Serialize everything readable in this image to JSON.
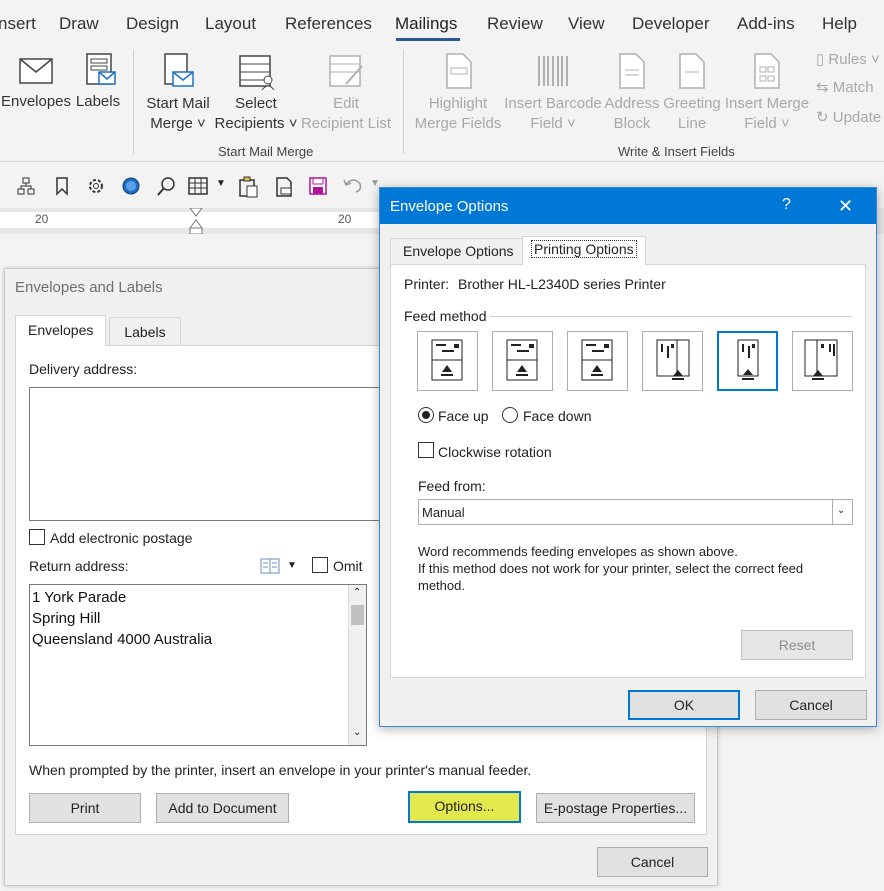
{
  "ribbon_tabs": [
    "nsert",
    "Draw",
    "Design",
    "Layout",
    "References",
    "Mailings",
    "Review",
    "View",
    "Developer",
    "Add-ins",
    "Help"
  ],
  "ribbon": {
    "envelopes": "Envelopes",
    "labels": "Labels",
    "start_mail_merge_1": "Start Mail",
    "start_mail_merge_2": "Merge ˅",
    "select_recipients_1": "Select",
    "select_recipients_2": "Recipients ˅",
    "edit_list_1": "Edit",
    "edit_list_2": "Recipient List",
    "highlight_1": "Highlight",
    "highlight_2": "Merge Fields",
    "barcode_1": "Insert Barcode",
    "barcode_2": "Field ˅",
    "address_1": "Address",
    "address_2": "Block",
    "greeting_1": "Greeting",
    "greeting_2": "Line",
    "merge_field_1": "Insert Merge",
    "merge_field_2": "Field ˅",
    "rules": "Rules ˅",
    "match": "Match",
    "update": "Update",
    "group_start": "Start Mail Merge",
    "group_write": "Write & Insert Fields"
  },
  "ruler": {
    "left_mark": "20",
    "right_mark": "20"
  },
  "env_dialog": {
    "title": "Envelopes and Labels",
    "tab_envelopes": "Envelopes",
    "tab_labels": "Labels",
    "delivery_label": "Delivery address:",
    "add_postage": "Add electronic postage",
    "return_label": "Return address:",
    "omit": "Omit",
    "return_lines": [
      "1 York Parade",
      "Spring Hill",
      "Queensland 4000 Australia"
    ],
    "prompt": "When prompted by the printer, insert an envelope in your printer's manual feeder.",
    "print": "Print",
    "add_to_doc": "Add to Document",
    "options": "Options...",
    "epostage": "E-postage Properties...",
    "cancel": "Cancel"
  },
  "opt_dialog": {
    "title": "Envelope Options",
    "help": "?",
    "close": "✕",
    "tab_env": "Envelope Options",
    "tab_print": "Printing Options",
    "printer_label": "Printer:",
    "printer_value": "Brother HL-L2340D series Printer",
    "feed_method": "Feed method",
    "face_up": "Face up",
    "face_down": "Face down",
    "clockwise": "Clockwise rotation",
    "feed_from_label": "Feed from:",
    "feed_from_value": "Manual",
    "note1": "Word recommends feeding envelopes as shown above.",
    "note2": "If this method does not work for your printer, select the correct feed",
    "note3": "method.",
    "reset": "Reset",
    "ok": "OK",
    "cancel": "Cancel"
  },
  "colors": {
    "accent": "#0078d7",
    "tab_underline": "#2b579a",
    "highlight": "#e3e84c"
  }
}
